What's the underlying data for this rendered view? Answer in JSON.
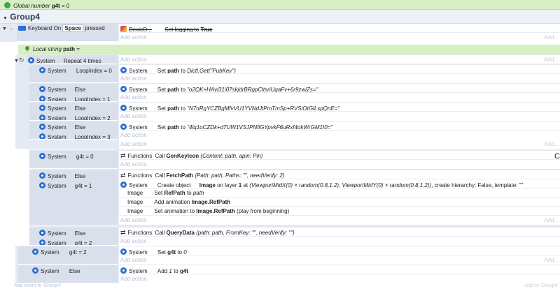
{
  "global_var": {
    "label": "Global number",
    "name": "g4t",
    "value": "= 0"
  },
  "group": {
    "title": "Group4"
  },
  "event_keyboard": {
    "object": "Keyboard",
    "cond_prefix": "On",
    "key": "Space",
    "cond_suffix": "pressed",
    "action_obj": "DexieD...",
    "action_prefix": "Set logging to",
    "action_value": "True"
  },
  "local_var": {
    "label": "Local string",
    "name": "path",
    "value": "="
  },
  "loop_event": {
    "object": "System",
    "cond": "Repeat 4 times"
  },
  "common": {
    "system": "System",
    "else": "Else",
    "add_action": "Add action",
    "add_text": "Add...",
    "functions": "Functions",
    "image": "Image",
    "set": "Set",
    "to": "to",
    "path_var": "path"
  },
  "loop_rows": [
    {
      "cond": "LoopIndex = 0",
      "val": "Dictl.Get(\"PubKey\")"
    },
    {
      "cond": "LoopIndex = 1",
      "val": "\"o2QK+HAvl31i07skjdrBRgpCltsriUgaFv+6r9zwiZs=\""
    },
    {
      "cond": "LoopIndex = 2",
      "val": "\"N7nRgYCZBgMfvVU1YVNdJtPmTmSp+RVSiOtGlLspQnE=\""
    },
    {
      "cond": "LoopIndex = 3",
      "val": "\"4lq1oCZDk+d7UW1VSJPNfiGYpvkF6uRxf4okWrGM1I0=\""
    }
  ],
  "g4t0": {
    "cond": "g4t = 0",
    "call": "Call",
    "fn": "GenKeyIcon",
    "args": "(Content: path, apin: Pin)"
  },
  "g4t1": {
    "cond": "g4t = 1",
    "fetch_call": "Call",
    "fetch_fn": "FetchPath",
    "fetch_args": "(Path: path, Paths: \"\", needVerify: 2)",
    "create_prefix": "Create object",
    "create_obj": "Image",
    "create_mid": "on layer",
    "create_layer": "1",
    "create_at": "at",
    "create_xy": "(ViewportMidX(0) × random(0.8,1.2), ViewportMidY(0) × random(0.8,1.2))",
    "create_tail": ", create hierarchy: False, template: \"\"",
    "a2_prefix": "Set",
    "a2_bold": "RefPath",
    "a2_to": "to",
    "a2_val": "path",
    "a3_prefix": "Add animation",
    "a3_bold": "Image.RefPath",
    "a4_prefix": "Set animation to",
    "a4_bold": "Image.RefPath",
    "a4_tail": "(play from beginning)"
  },
  "g4t2_query": {
    "cond": "g4t = 2",
    "call": "Call",
    "fn": "QueryData",
    "args": "(path: path, FromKey: \"\", needVerify: \"\")"
  },
  "g4t2_outer": {
    "cond": "g4t = 2",
    "prefix": "Set",
    "var": "g4t",
    "to": "to",
    "val": "0"
  },
  "else_add": {
    "prefix": "Add",
    "val": "1",
    "to": "to",
    "var": "g4t"
  },
  "footer": {
    "left": "Add event to 'Group4'",
    "right": "Add to 'Group4'"
  }
}
